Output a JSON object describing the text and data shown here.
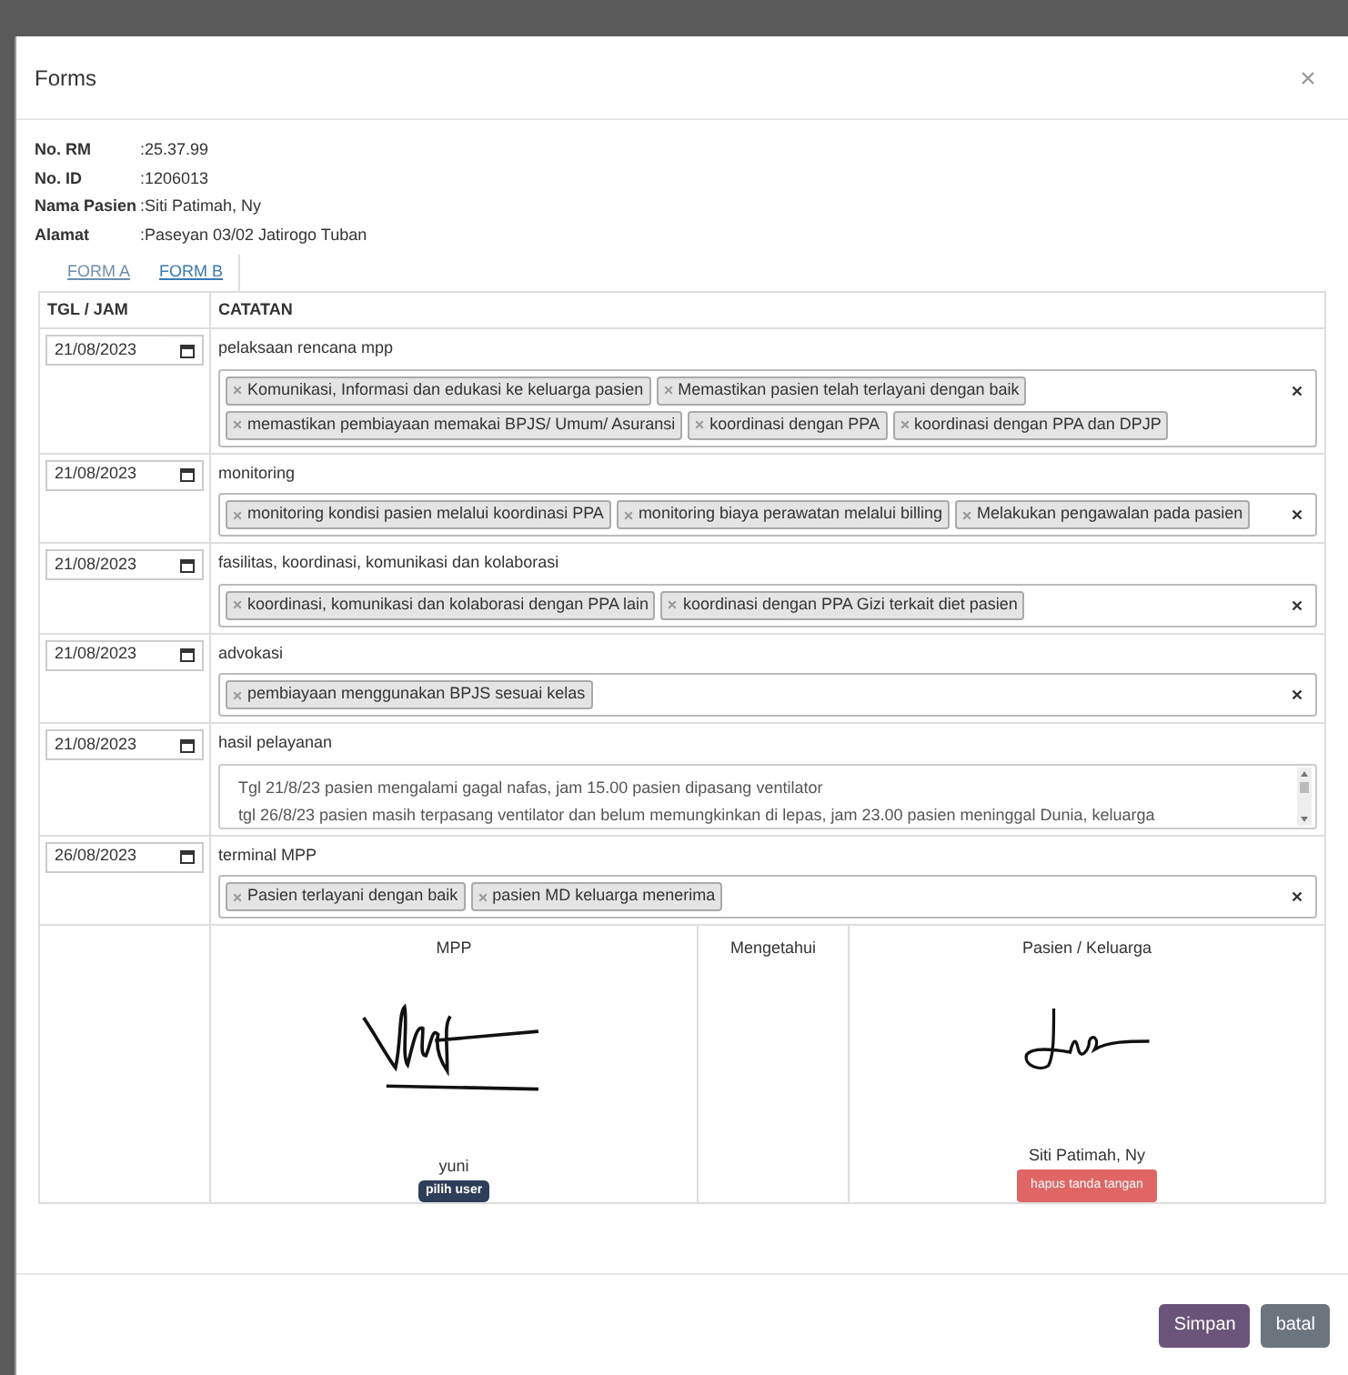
{
  "dialog": {
    "title": "Forms"
  },
  "patient": [
    {
      "label": "No. RM",
      "value": ":25.37.99"
    },
    {
      "label": "No. ID",
      "value": ":1206013"
    },
    {
      "label": "Nama Pasien",
      "value": ":Siti Patimah, Ny"
    },
    {
      "label": "Alamat",
      "value": ":Paseyan 03/02 Jatirogo Tuban"
    }
  ],
  "tabs": [
    {
      "label": "FORM A",
      "selected": false
    },
    {
      "label": "FORM B",
      "selected": true
    }
  ],
  "table": {
    "columns": [
      "TGL / JAM",
      "CATATAN"
    ],
    "rows": [
      {
        "date": "21/08/2023",
        "title": "pelaksaan rencana mpp",
        "kind": "tags",
        "tags": [
          "Komunikasi, Informasi dan edukasi ke keluarga pasien",
          "Memastikan pasien telah terlayani dengan baik",
          "memastikan pembiayaan memakai BPJS/ Umum/ Asuransi",
          "koordinasi dengan PPA",
          "koordinasi dengan PPA dan DPJP"
        ]
      },
      {
        "date": "21/08/2023",
        "title": "monitoring",
        "kind": "tags",
        "tags": [
          "monitoring kondisi pasien melalui koordinasi PPA",
          "monitoring biaya perawatan melalui billing",
          "Melakukan pengawalan pada pasien"
        ]
      },
      {
        "date": "21/08/2023",
        "title": "fasilitas, koordinasi, komunikasi dan kolaborasi",
        "kind": "tags",
        "tags": [
          "koordinasi, komunikasi dan kolaborasi dengan PPA lain",
          "koordinasi dengan PPA Gizi terkait diet pasien"
        ]
      },
      {
        "date": "21/08/2023",
        "title": "advokasi",
        "kind": "tags",
        "tags": [
          "pembiayaan menggunakan BPJS sesuai kelas"
        ]
      },
      {
        "date": "21/08/2023",
        "title": "hasil pelayanan",
        "kind": "text",
        "lines": [
          "Tgl 21/8/23 pasien mengalami gagal nafas, jam 15.00 pasien dipasang ventilator",
          "tgl 26/8/23 pasien masih terpasang ventilator dan belum memungkinkan di lepas, jam 23.00 pasien meninggal Dunia, keluarga"
        ]
      },
      {
        "date": "26/08/2023",
        "title": "terminal MPP",
        "kind": "tags",
        "tags": [
          "Pasien terlayani dengan baik",
          "pasien MD keluarga menerima"
        ]
      }
    ]
  },
  "signatures": [
    {
      "heading": "MPP",
      "signed": true,
      "name": "yuni",
      "button": {
        "label": "pilih user",
        "kind": "select"
      }
    },
    {
      "heading": "Mengetahui"
    },
    {
      "heading": "Pasien / Keluarga",
      "signed": true,
      "name": "Siti Patimah, Ny",
      "button": {
        "label": "hapus tanda tangan",
        "kind": "delete"
      }
    }
  ],
  "footer_buttons": [
    {
      "label": "Simpan",
      "kind": "primary"
    },
    {
      "label": "batal",
      "kind": "secondary"
    }
  ]
}
